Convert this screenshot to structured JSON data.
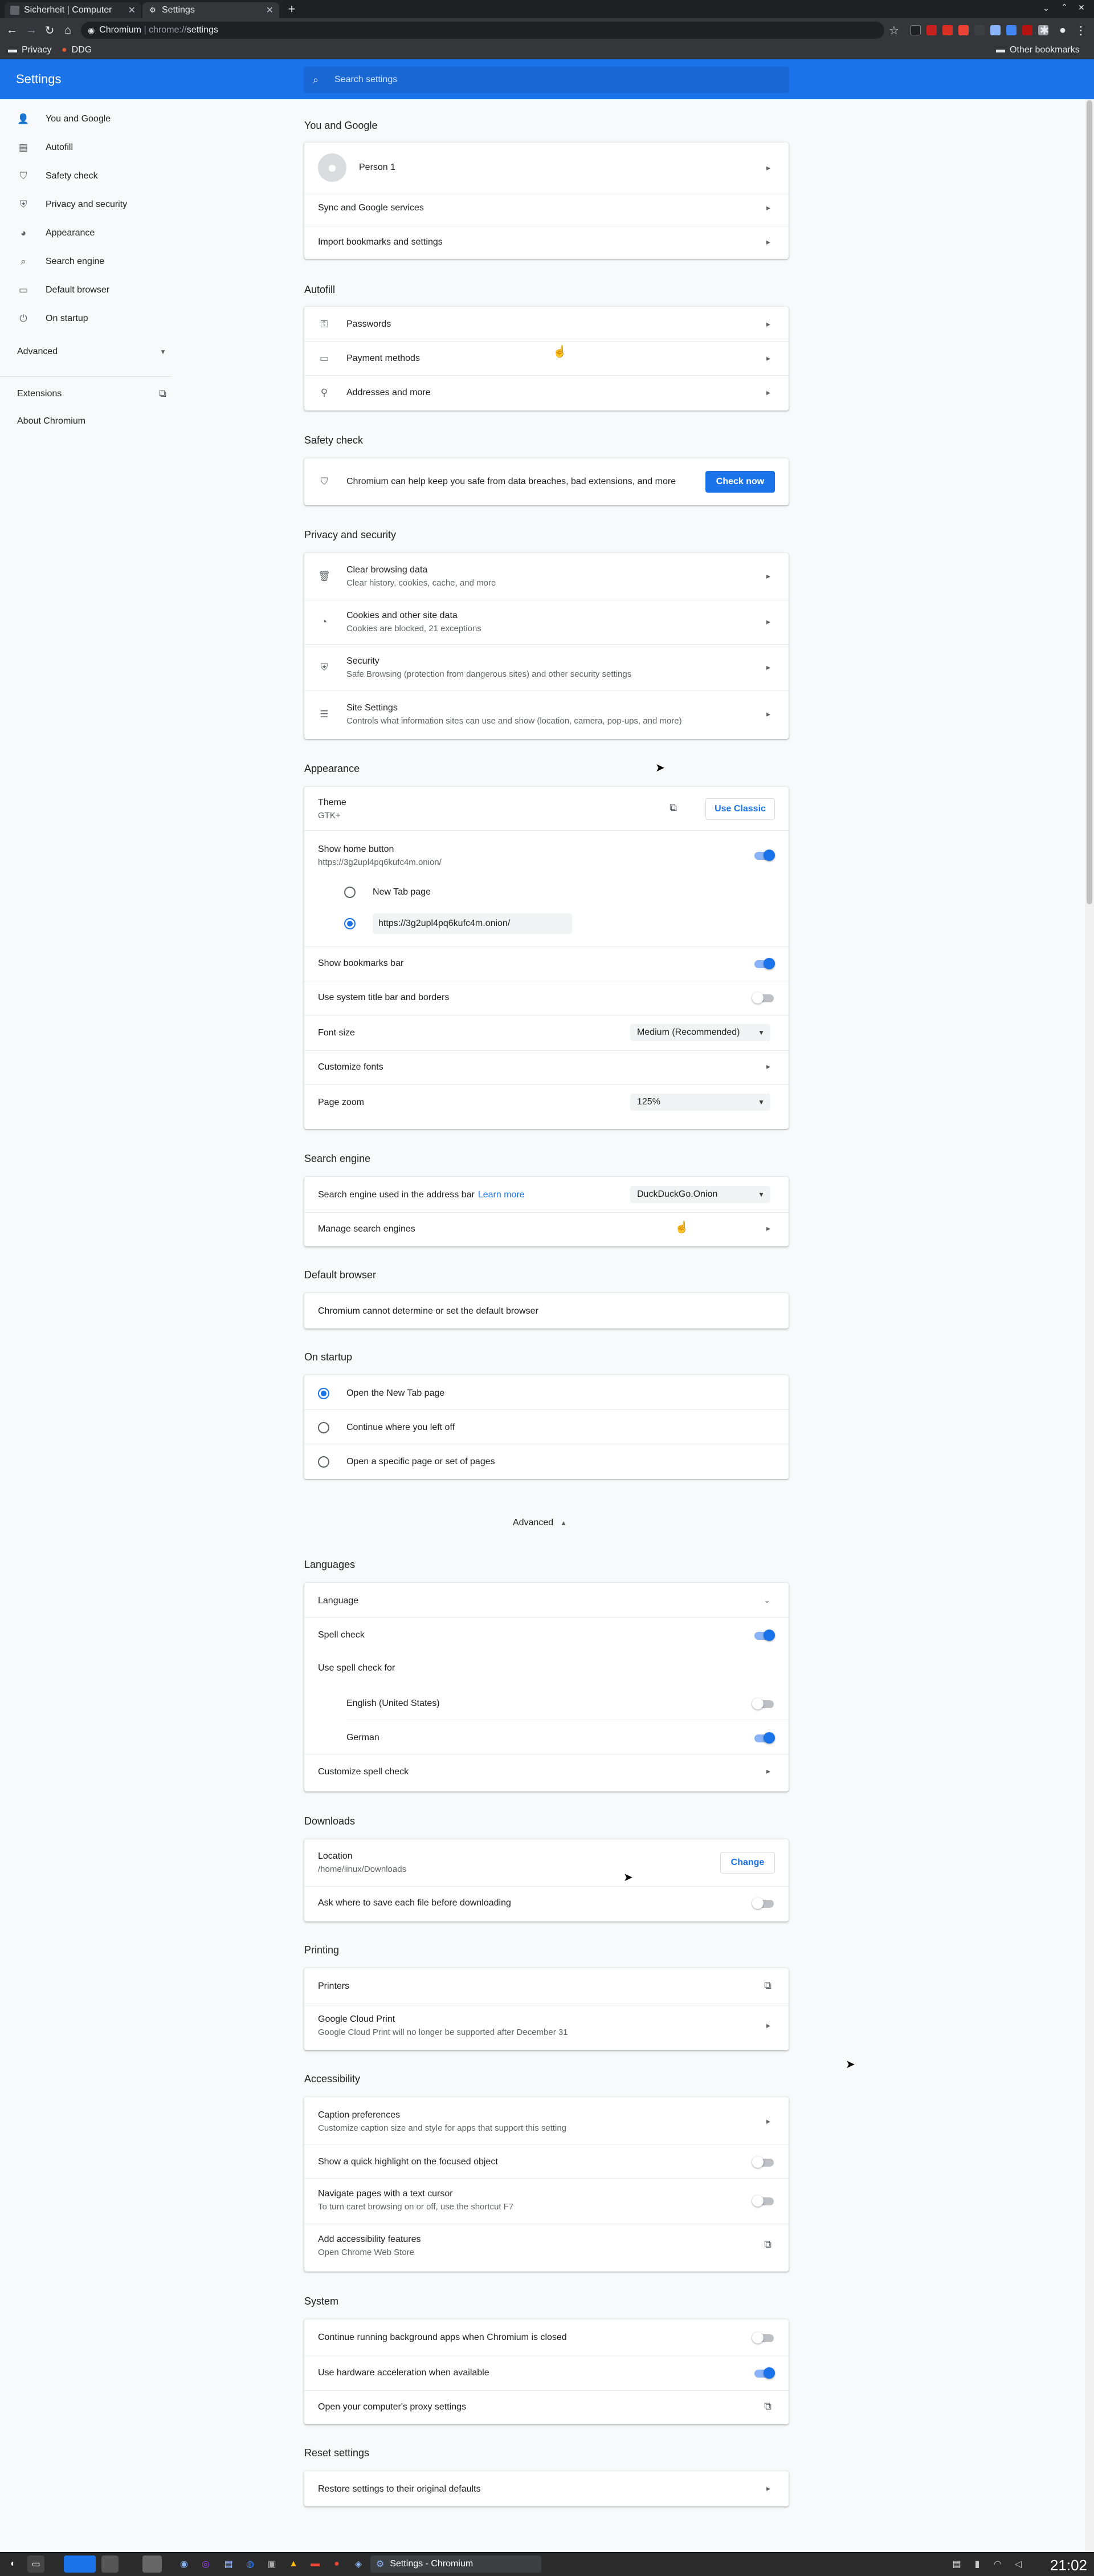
{
  "tabs": [
    {
      "title": "Sicherheit | Computer",
      "active": false
    },
    {
      "title": "Settings",
      "active": true
    }
  ],
  "omnibox": {
    "chip": "Chromium",
    "sep": " | ",
    "scheme": "chrome://",
    "path": "settings"
  },
  "bookmarks": {
    "items": [
      "Privacy",
      "DDG"
    ],
    "other": "Other bookmarks"
  },
  "header": {
    "title": "Settings",
    "search_placeholder": "Search settings"
  },
  "sidebar": {
    "items": [
      {
        "label": "You and Google",
        "icon": "person-icon"
      },
      {
        "label": "Autofill",
        "icon": "clipboard-icon"
      },
      {
        "label": "Safety check",
        "icon": "shield-check-icon"
      },
      {
        "label": "Privacy and security",
        "icon": "shield-icon"
      },
      {
        "label": "Appearance",
        "icon": "palette-icon"
      },
      {
        "label": "Search engine",
        "icon": "search-icon"
      },
      {
        "label": "Default browser",
        "icon": "browser-icon"
      },
      {
        "label": "On startup",
        "icon": "power-icon"
      }
    ],
    "advanced": "Advanced",
    "extensions": "Extensions",
    "about": "About Chromium"
  },
  "you_and_google": {
    "title": "You and Google",
    "person": "Person 1",
    "sync": "Sync and Google services",
    "import": "Import bookmarks and settings"
  },
  "autofill": {
    "title": "Autofill",
    "passwords": "Passwords",
    "payment": "Payment methods",
    "addresses": "Addresses and more"
  },
  "safety_check": {
    "title": "Safety check",
    "text": "Chromium can help keep you safe from data breaches, bad extensions, and more",
    "button": "Check now"
  },
  "privacy": {
    "title": "Privacy and security",
    "items": [
      {
        "label": "Clear browsing data",
        "sub": "Clear history, cookies, cache, and more"
      },
      {
        "label": "Cookies and other site data",
        "sub": "Cookies are blocked, 21 exceptions"
      },
      {
        "label": "Security",
        "sub": "Safe Browsing (protection from dangerous sites) and other security settings"
      },
      {
        "label": "Site Settings",
        "sub": "Controls what information sites can use and show (location, camera, pop-ups, and more)"
      }
    ]
  },
  "appearance": {
    "title": "Appearance",
    "theme": "Theme",
    "theme_sub": "GTK+",
    "use_classic": "Use Classic",
    "home_button": "Show home button",
    "home_url": "https://3g2upl4pq6kufc4m.onion/",
    "new_tab_page": "New Tab page",
    "home_input": "https://3g2upl4pq6kufc4m.onion/",
    "bookmarks_bar": "Show bookmarks bar",
    "system_title_bar": "Use system title bar and borders",
    "font_size": "Font size",
    "font_size_value": "Medium (Recommended)",
    "customize_fonts": "Customize fonts",
    "page_zoom": "Page zoom",
    "page_zoom_value": "125%",
    "toggles": {
      "home_button": true,
      "bookmarks_bar": true,
      "system_title_bar": false
    }
  },
  "search_engine": {
    "title": "Search engine",
    "label": "Search engine used in the address bar",
    "learn_more": "Learn more",
    "value": "DuckDuckGo.Onion",
    "manage": "Manage search engines"
  },
  "default_browser": {
    "title": "Default browser",
    "text": "Chromium cannot determine or set the default browser"
  },
  "on_startup": {
    "title": "On startup",
    "options": [
      "Open the New Tab page",
      "Continue where you left off",
      "Open a specific page or set of pages"
    ],
    "selected": 0
  },
  "advanced_toggle": "Advanced",
  "languages": {
    "title": "Languages",
    "language": "Language",
    "spell_check": "Spell check",
    "use_for": "Use spell check for",
    "english": "English (United States)",
    "german": "German",
    "customize": "Customize spell check",
    "toggles": {
      "spell_check": true,
      "english": false,
      "german": true
    }
  },
  "downloads": {
    "title": "Downloads",
    "location": "Location",
    "location_path": "/home/linux/Downloads",
    "change": "Change",
    "ask": "Ask where to save each file before downloading",
    "toggles": {
      "ask": false
    }
  },
  "printing": {
    "title": "Printing",
    "printers": "Printers",
    "cloud_print": "Google Cloud Print",
    "cloud_print_sub": "Google Cloud Print will no longer be supported after December 31"
  },
  "accessibility": {
    "title": "Accessibility",
    "captions": "Caption preferences",
    "captions_sub": "Customize caption size and style for apps that support this setting",
    "highlight": "Show a quick highlight on the focused object",
    "caret": "Navigate pages with a text cursor",
    "caret_sub": "To turn caret browsing on or off, use the shortcut F7",
    "add_features": "Add accessibility features",
    "add_features_sub": "Open Chrome Web Store",
    "toggles": {
      "highlight": false,
      "caret": false
    }
  },
  "system": {
    "title": "System",
    "background": "Continue running background apps when Chromium is closed",
    "hardware": "Use hardware acceleration when available",
    "proxy": "Open your computer's proxy settings",
    "toggles": {
      "background": false,
      "hardware": true
    }
  },
  "reset": {
    "title": "Reset settings",
    "restore": "Restore settings to their original defaults"
  },
  "taskbar": {
    "active_window": "Settings - Chromium",
    "clock": "21:02"
  },
  "colors": {
    "accent": "#1a73e8",
    "header": "#1a73e8",
    "chrome_dark": "#35363a"
  }
}
